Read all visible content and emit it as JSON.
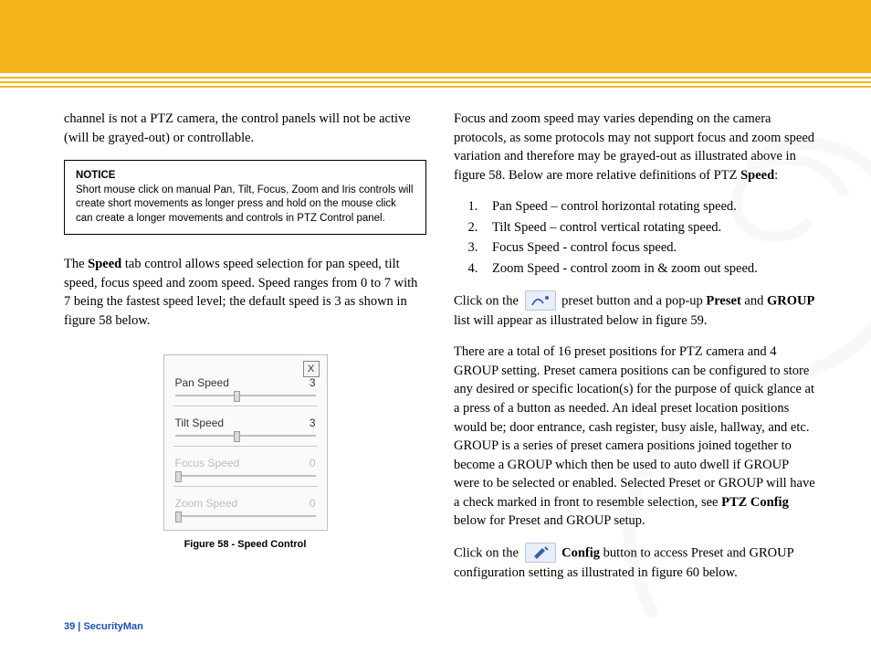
{
  "left": {
    "intro": "channel is not a PTZ camera, the control panels will not be active (will be grayed-out) or controllable.",
    "notice_title": "NOTICE",
    "notice_body": "Short mouse click on manual Pan, Tilt, Focus, Zoom and Iris controls will create short movements as longer press and hold on the mouse click can create a longer movements and controls in PTZ Control panel.",
    "speed_para_pre": "The ",
    "speed_bold": "Speed",
    "speed_para_post": " tab control allows speed selection for pan speed, tilt speed, focus speed and zoom speed.  Speed ranges from 0 to 7 with 7 being the fastest speed level; the default speed is 3 as shown in figure 58 below.",
    "panel": {
      "close": "X",
      "rows": [
        {
          "label": "Pan Speed",
          "value": "3",
          "disabled": false
        },
        {
          "label": "Tilt Speed",
          "value": "3",
          "disabled": false
        },
        {
          "label": "Focus Speed",
          "value": "0",
          "disabled": true
        },
        {
          "label": "Zoom Speed",
          "value": "0",
          "disabled": true
        }
      ]
    },
    "figure_caption": "Figure 58 - Speed Control"
  },
  "right": {
    "focus_para_pre": "Focus and zoom speed may varies depending on the camera protocols, as some protocols may not support focus and zoom speed variation and therefore may be grayed-out as illustrated above in figure 58. Below are more relative definitions of PTZ ",
    "focus_bold": "Speed",
    "focus_para_post": ":",
    "list": [
      "Pan Speed – control horizontal rotating speed.",
      "Tilt Speed – control vertical rotating speed.",
      "Focus Speed - control focus speed.",
      "Zoom Speed - control zoom in & zoom out speed."
    ],
    "preset_pre": "Click on the ",
    "preset_mid1": " preset button and a pop-up ",
    "preset_bold1": "Preset",
    "preset_mid2": " and ",
    "preset_bold2": "GROUP",
    "preset_post": " list will appear as illustrated below in figure 59.",
    "group_para_pre": "There are a total of 16 preset positions for PTZ camera and 4 GROUP setting.  Preset camera positions can be configured to store any desired or specific location(s) for the purpose of quick glance at a press of a button as needed.  An ideal preset location positions would be; door entrance, cash register, busy aisle, hallway, and etc.  GROUP is a series of preset camera positions joined together to become a GROUP which then be used to auto dwell if GROUP were to be selected or enabled.  Selected Preset or GROUP will have a check marked in front to resemble selection, see ",
    "group_bold": "PTZ Config",
    "group_para_post": " below for Preset and GROUP setup.",
    "config_pre": "Click on the ",
    "config_bold": "Config",
    "config_post": " button to access Preset and GROUP configuration setting as illustrated in figure 60 below."
  },
  "footer": {
    "page": "39",
    "sep": "  |  ",
    "brand": "SecurityMan"
  }
}
